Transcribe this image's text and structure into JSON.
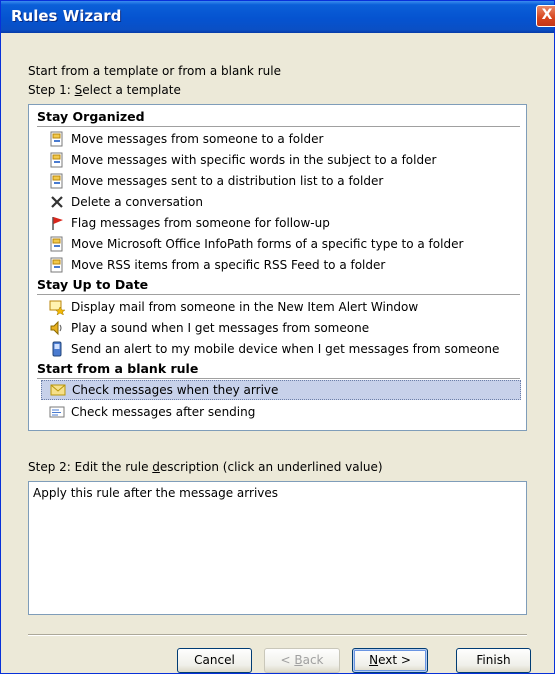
{
  "window": {
    "title": "Rules Wizard",
    "close_glyph": "X"
  },
  "intro_text": "Start from a template or from a blank rule",
  "step1": {
    "prefix": "Step 1: ",
    "accel": "S",
    "rest": "elect a template"
  },
  "groups": [
    {
      "header": "Stay Organized",
      "items": [
        {
          "label": "Move messages from someone to a folder",
          "icon": "folder-move-icon"
        },
        {
          "label": "Move messages with specific words in the subject to a folder",
          "icon": "folder-move-icon"
        },
        {
          "label": "Move messages sent to a distribution list to a folder",
          "icon": "folder-move-icon"
        },
        {
          "label": "Delete a conversation",
          "icon": "delete-x-icon"
        },
        {
          "label": "Flag messages from someone for follow-up",
          "icon": "flag-icon"
        },
        {
          "label": "Move Microsoft Office InfoPath forms of a specific type to a folder",
          "icon": "folder-move-icon"
        },
        {
          "label": "Move RSS items from a specific RSS Feed to a folder",
          "icon": "folder-move-icon"
        }
      ]
    },
    {
      "header": "Stay Up to Date",
      "items": [
        {
          "label": "Display mail from someone in the New Item Alert Window",
          "icon": "alert-window-icon"
        },
        {
          "label": "Play a sound when I get messages from someone",
          "icon": "speaker-icon"
        },
        {
          "label": "Send an alert to my mobile device when I get messages from someone",
          "icon": "mobile-device-icon"
        }
      ]
    },
    {
      "header": "Start from a blank rule",
      "items": [
        {
          "label": "Check messages when they arrive",
          "icon": "envelope-icon",
          "selected": true
        },
        {
          "label": "Check messages after sending",
          "icon": "sent-mail-icon"
        }
      ]
    }
  ],
  "step2": {
    "prefix": "Step 2: Edit the rule ",
    "accel": "d",
    "rest": "escription (click an underlined value)"
  },
  "description_text": "Apply this rule after the message arrives",
  "buttons": {
    "cancel": "Cancel",
    "back_prefix": "< ",
    "back_accel": "B",
    "back_rest": "ack",
    "next_accel": "N",
    "next_rest": "ext >",
    "finish": "Finish"
  },
  "colors": {
    "title_bar": "#0553d0",
    "selection": "#c7d1ea",
    "window_bg": "#ece9d8"
  }
}
